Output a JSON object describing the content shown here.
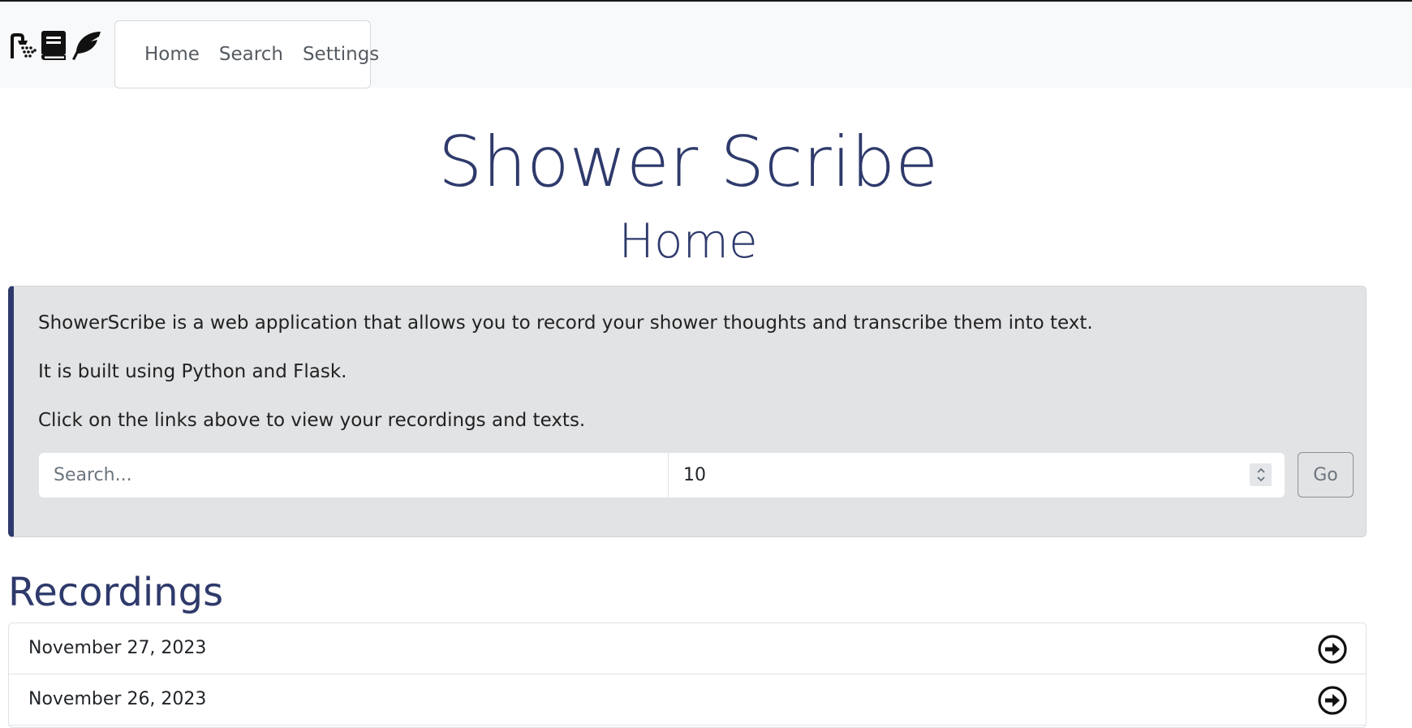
{
  "nav": {
    "links": [
      "Home",
      "Search",
      "Settings"
    ]
  },
  "header": {
    "title": "Shower Scribe",
    "subtitle": "Home"
  },
  "info": {
    "paragraphs": [
      "ShowerScribe is a web application that allows you to record your shower thoughts and transcribe them into text.",
      "It is built using Python and Flask.",
      "Click on the links above to view your recordings and texts."
    ],
    "search_placeholder": "Search...",
    "count_value": "10",
    "go_label": "Go"
  },
  "recordings": {
    "heading": "Recordings",
    "items": [
      {
        "date": "November 27, 2023"
      },
      {
        "date": "November 26, 2023"
      }
    ]
  },
  "icons": {
    "logo": [
      "shower-icon",
      "book-icon",
      "feather-icon"
    ],
    "row_action": "arrow-circle-right-icon",
    "spinner": "chevron-updown-icon"
  },
  "colors": {
    "accent": "#2e3a6b",
    "navbar_bg": "#f8f9fa",
    "info_bg": "#e2e3e5"
  }
}
